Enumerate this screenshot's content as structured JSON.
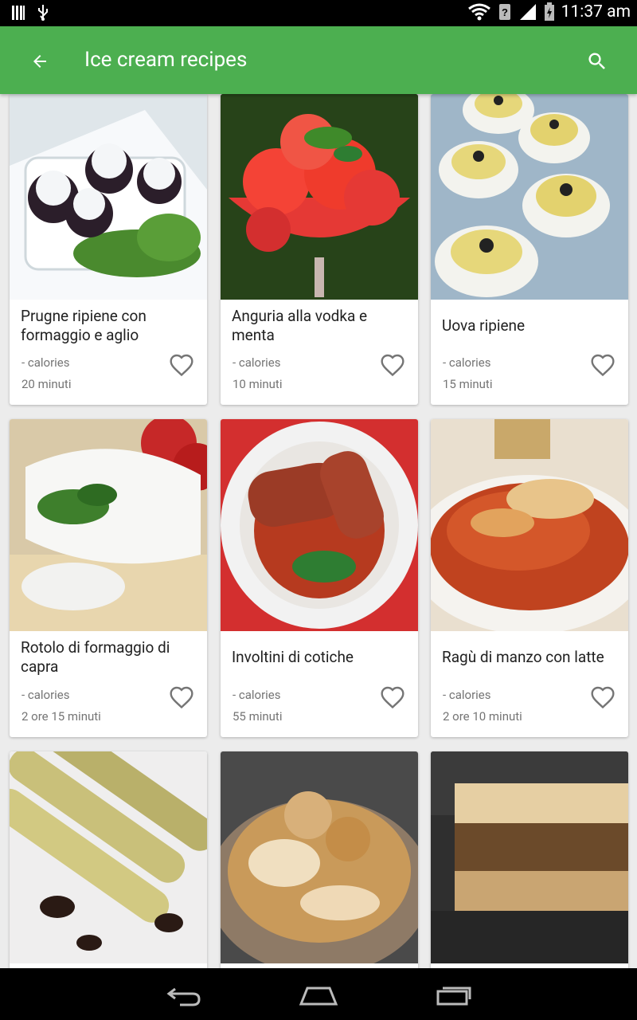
{
  "status_bar": {
    "time": "11:37 am"
  },
  "app_bar": {
    "title": "Ice cream recipes"
  },
  "recipes": [
    {
      "name": "Prugne ripiene con formaggio e aglio",
      "calories": "- calories",
      "time": "20 minuti"
    },
    {
      "name": "Anguria alla vodka e menta",
      "calories": "- calories",
      "time": "10 minuti"
    },
    {
      "name": "Uova ripiene",
      "calories": "- calories",
      "time": "15 minuti"
    },
    {
      "name": "Rotolo di formaggio di capra",
      "calories": "- calories",
      "time": "2 ore 15 minuti"
    },
    {
      "name": "Involtini di cotiche",
      "calories": "- calories",
      "time": "55 minuti"
    },
    {
      "name": "Ragù di manzo con latte",
      "calories": "- calories",
      "time": "2 ore 10 minuti"
    }
  ],
  "colors": {
    "primary": "#4caf50",
    "status_bar": "#000000",
    "card": "#ffffff"
  }
}
